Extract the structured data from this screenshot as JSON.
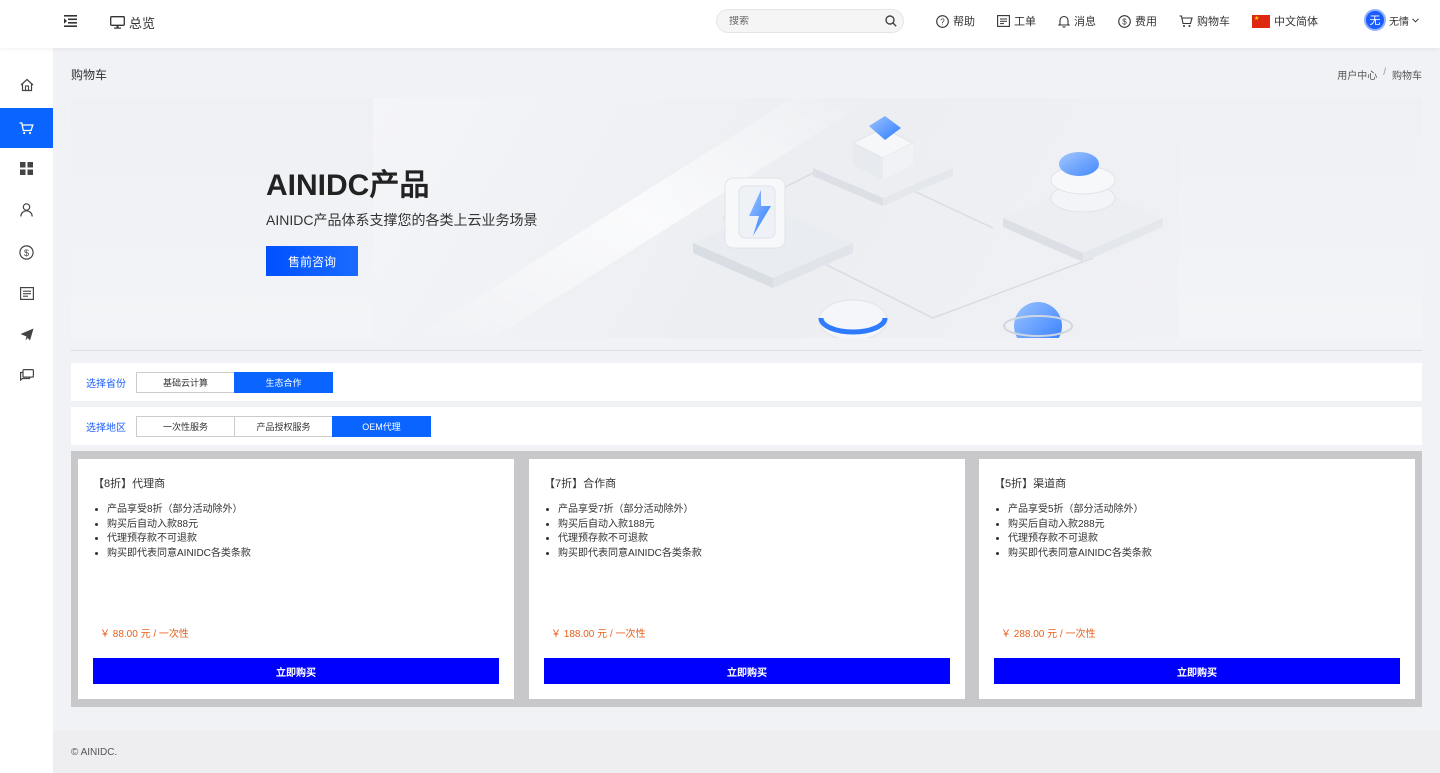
{
  "topbar": {
    "overview_label": "总览",
    "search_placeholder": "搜索",
    "nav": [
      {
        "label": "帮助",
        "icon": "help-icon"
      },
      {
        "label": "工单",
        "icon": "ticket-icon"
      },
      {
        "label": "消息",
        "icon": "bell-icon"
      },
      {
        "label": "费用",
        "icon": "dollar-icon"
      },
      {
        "label": "购物车",
        "icon": "cart-icon"
      }
    ],
    "language": "中文简体",
    "avatar_char": "无",
    "user_name": "无情"
  },
  "sidebar": {
    "items": [
      {
        "icon": "home-icon",
        "active": false
      },
      {
        "icon": "cart-icon",
        "active": true
      },
      {
        "icon": "grid-icon",
        "active": false
      },
      {
        "icon": "user-icon",
        "active": false
      },
      {
        "icon": "dollar-icon",
        "active": false
      },
      {
        "icon": "list-icon",
        "active": false
      },
      {
        "icon": "send-icon",
        "active": false
      },
      {
        "icon": "chat-icon",
        "active": false
      }
    ]
  },
  "page": {
    "title": "购物车",
    "breadcrumb": [
      "用户中心",
      "购物车"
    ]
  },
  "banner": {
    "title": "AINIDC产品",
    "subtitle": "AINIDC产品体系支撑您的各类上云业务场景",
    "button": "售前咨询"
  },
  "filters": {
    "province": {
      "label": "选择省份",
      "options": [
        "基础云计算",
        "生态合作"
      ],
      "selected": "生态合作"
    },
    "region": {
      "label": "选择地区",
      "options": [
        "一次性服务",
        "产品授权服务",
        "OEM代理"
      ],
      "selected": "OEM代理"
    }
  },
  "products": [
    {
      "title": "【8折】代理商",
      "features": [
        "产品享受8折（部分活动除外）",
        "购买后自动入款88元",
        "代理预存款不可退款",
        "购买即代表同意AINIDC各类条款"
      ],
      "price": "￥ 88.00 元 / 一次性",
      "buy_label": "立即购买"
    },
    {
      "title": "【7折】合作商",
      "features": [
        "产品享受7折（部分活动除外）",
        "购买后自动入款188元",
        "代理预存款不可退款",
        "购买即代表同意AINIDC各类条款"
      ],
      "price": "￥ 188.00 元 / 一次性",
      "buy_label": "立即购买"
    },
    {
      "title": "【5折】渠道商",
      "features": [
        "产品享受5折（部分活动除外）",
        "购买后自动入款288元",
        "代理预存款不可退款",
        "购买即代表同意AINIDC各类条款"
      ],
      "price": "￥ 288.00 元 / 一次性",
      "buy_label": "立即购买"
    }
  ],
  "footer": {
    "copyright": "© AINIDC."
  },
  "colors": {
    "accent": "#0a64ff",
    "buy_button": "#0000ff",
    "price": "#e8601c"
  }
}
